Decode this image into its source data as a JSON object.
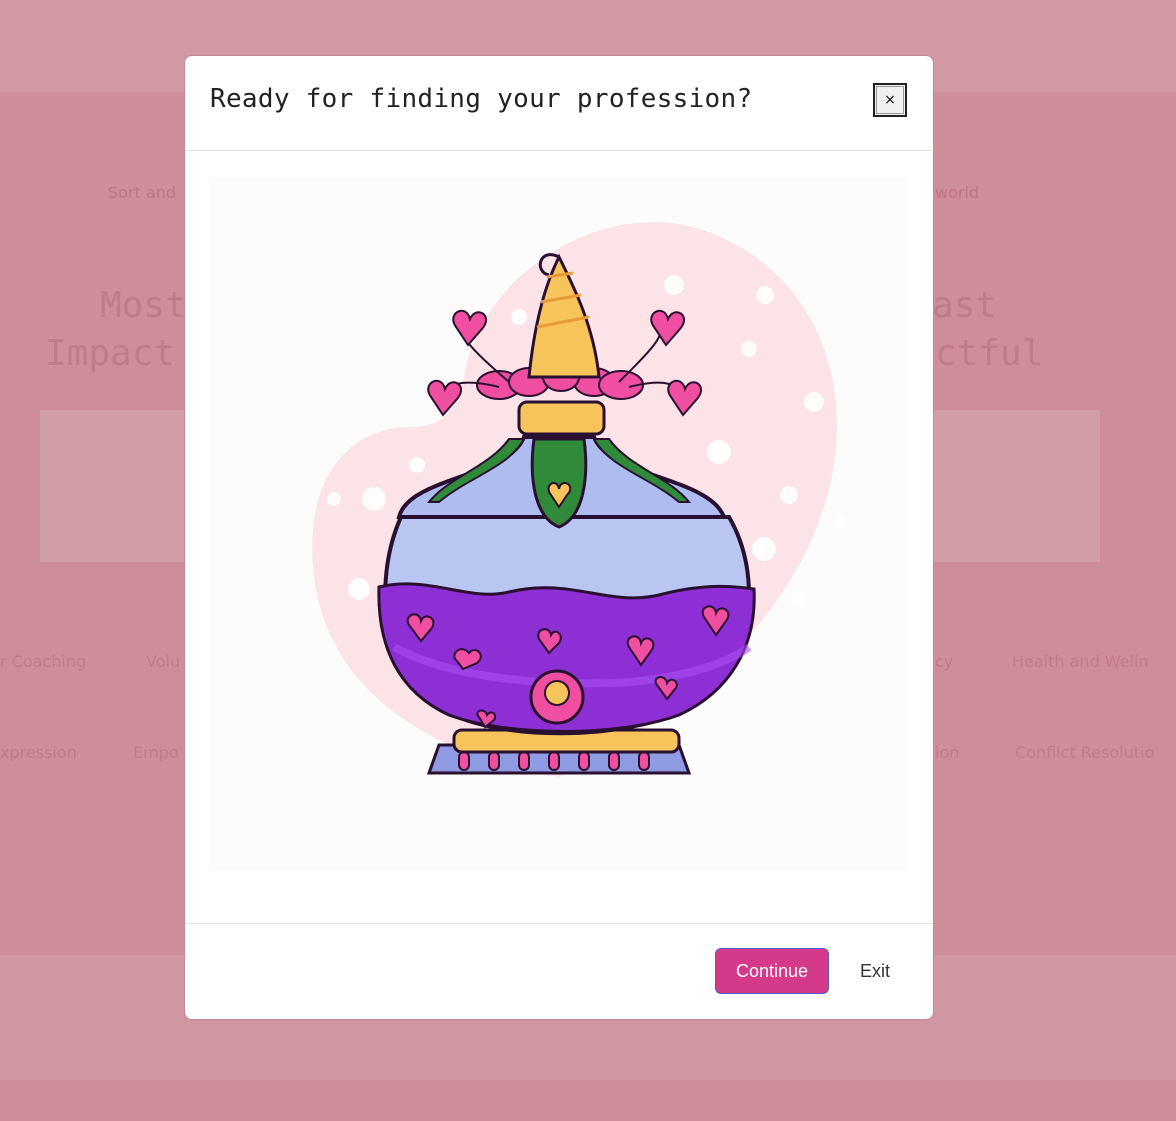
{
  "background": {
    "subtitle_left": "Sort and",
    "subtitle_right": "world",
    "heading_left_line1": "Most",
    "heading_left_line2": "Impact",
    "heading_right_line1": "ast",
    "heading_right_line2": "ctful",
    "tags_row1": [
      "r Coaching",
      "Volu",
      "cy",
      "Health and Welln"
    ],
    "tags_row2": [
      "xpression",
      "Empo",
      "ion",
      "Conflict Resolutio"
    ]
  },
  "modal": {
    "title": "Ready for finding your profession?",
    "close_label": "×",
    "illustration_icon": "potion-bottle-illustration",
    "continue_label": "Continue",
    "exit_label": "Exit"
  },
  "colors": {
    "backdrop": "#f4c2cc",
    "accent": "#d53a8a",
    "potion_liquid": "#8e2fd6",
    "heart_pink": "#f04ea0"
  }
}
